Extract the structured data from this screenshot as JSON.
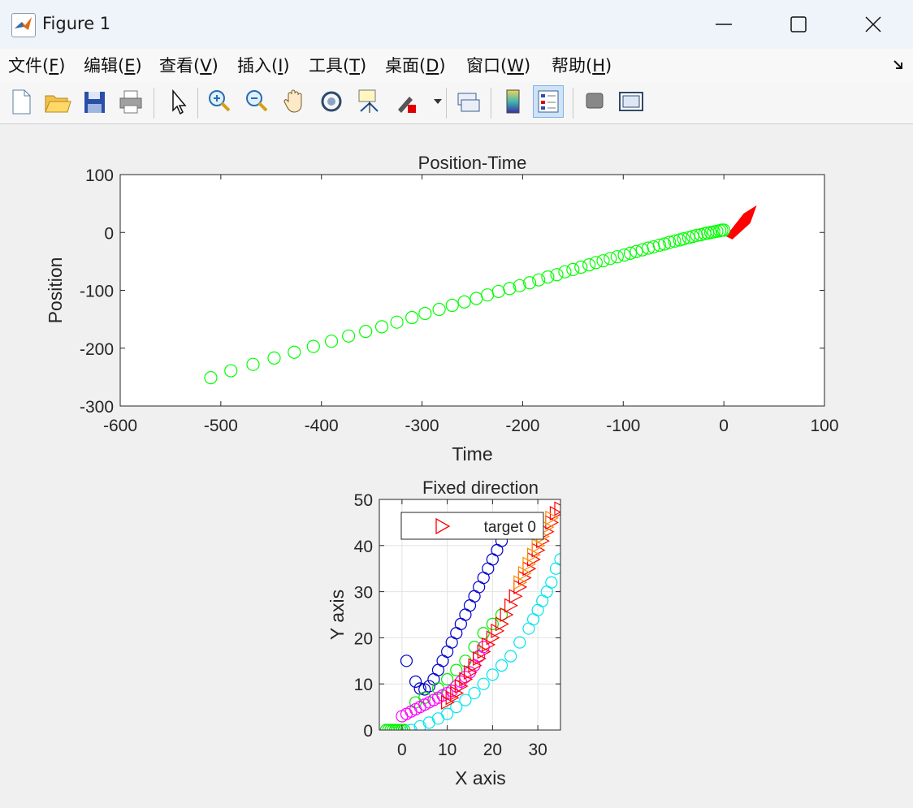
{
  "window": {
    "title": "Figure 1"
  },
  "menu": {
    "file": "文件(",
    "file_key": "F",
    "file_end": ")",
    "edit": "编辑(",
    "edit_key": "E",
    "edit_end": ")",
    "view": "查看(",
    "view_key": "V",
    "view_end": ")",
    "insert": "插入(",
    "insert_key": "I",
    "insert_end": ")",
    "tools": "工具(",
    "tools_key": "T",
    "tools_end": ")",
    "desktop": "桌面(",
    "desktop_key": "D",
    "desktop_end": ")",
    "window": "窗口(",
    "window_key": "W",
    "window_end": ")",
    "help": "帮助(",
    "help_key": "H",
    "help_end": ")"
  },
  "toolbar": {
    "icons": [
      "new-file-icon",
      "open-folder-icon",
      "save-icon",
      "print-icon",
      "pointer-icon",
      "zoom-in-icon",
      "zoom-out-icon",
      "pan-hand-icon",
      "rotate-3d-icon",
      "data-cursor-icon",
      "brush-icon",
      "link-plot-icon",
      "colorbar-icon",
      "legend-icon",
      "hide-plot-tools-icon",
      "show-plot-tools-icon"
    ]
  },
  "chart_data": [
    {
      "type": "scatter",
      "title": "Position-Time",
      "xlabel": "Time",
      "ylabel": "Position",
      "xlim": [
        -600,
        100
      ],
      "ylim": [
        -300,
        100
      ],
      "xticks": [
        "-600",
        "-500",
        "-400",
        "-300",
        "-200",
        "-100",
        "0",
        "100"
      ],
      "yticks": [
        "100",
        "0",
        "-100",
        "-200",
        "-300"
      ],
      "grid": false,
      "series": [
        {
          "marker": "circle",
          "color": "#00ff00",
          "x": [
            -510,
            -490,
            -468,
            -447,
            -427,
            -408,
            -390,
            -373,
            -356,
            -340,
            -325,
            -310,
            -297,
            -283,
            -270,
            -258,
            -246,
            -235,
            -224,
            -213,
            -203,
            -193,
            -184,
            -175,
            -166,
            -158,
            -150,
            -142,
            -134,
            -127,
            -120,
            -113,
            -106,
            -99,
            -93,
            -87,
            -81,
            -75,
            -70,
            -64,
            -59,
            -54,
            -49,
            -44,
            -40,
            -35,
            -31,
            -27,
            -23,
            -19,
            -16,
            -13,
            -10,
            -7,
            -4,
            -2,
            0
          ],
          "y": [
            -251,
            -239,
            -228,
            -217,
            -207,
            -197,
            -188,
            -179,
            -171,
            -163,
            -155,
            -147,
            -140,
            -133,
            -126,
            -120,
            -114,
            -108,
            -102,
            -97,
            -92,
            -87,
            -82,
            -77,
            -73,
            -68,
            -64,
            -60,
            -56,
            -52,
            -49,
            -45,
            -42,
            -39,
            -36,
            -33,
            -30,
            -27,
            -25,
            -22,
            -20,
            -17,
            -15,
            -13,
            -11,
            -9,
            -7,
            -5,
            -4,
            -2,
            -1,
            0,
            1,
            2,
            3,
            4,
            4
          ]
        }
      ],
      "annotation": {
        "shape": "arrow",
        "color": "#ff0000"
      }
    },
    {
      "type": "scatter",
      "title": "Fixed direction",
      "xlabel": "X axis",
      "ylabel": "Y axis",
      "xlim": [
        -5,
        35
      ],
      "ylim": [
        0,
        50
      ],
      "xticks": [
        "0",
        "10",
        "20",
        "30"
      ],
      "yticks": [
        "50",
        "40",
        "30",
        "20",
        "10",
        "0"
      ],
      "grid": true,
      "legend": {
        "label": "target 0",
        "marker": "triangle-right",
        "color": "#ff0000",
        "placement": "top"
      },
      "series": [
        {
          "color": "#0000cc",
          "marker": "circle",
          "x": [
            1,
            3,
            4,
            5,
            6,
            7,
            8,
            9,
            10,
            11,
            12,
            13,
            14,
            15,
            16,
            17,
            18,
            19,
            20,
            21,
            22,
            23,
            24
          ],
          "y": [
            15,
            10.5,
            9,
            8.8,
            9.5,
            11,
            13,
            15,
            17,
            19,
            21,
            23,
            25,
            27,
            29,
            31,
            33,
            35,
            37,
            39,
            41,
            43,
            44
          ]
        },
        {
          "color": "#00ee00",
          "marker": "circle",
          "x": [
            -3.5,
            -3,
            -2.5,
            -2,
            -1.5,
            -1,
            -0.5,
            0,
            0.5,
            3,
            5,
            8,
            10,
            12,
            14,
            16,
            18,
            20,
            22
          ],
          "y": [
            0,
            0,
            0,
            0,
            0,
            0,
            0,
            0,
            0,
            6,
            7,
            9,
            11,
            13,
            15,
            18,
            21,
            23,
            25
          ]
        },
        {
          "color": "#ff00ff",
          "marker": "circle",
          "x": [
            0,
            1,
            2,
            3,
            4,
            5,
            6,
            7,
            8,
            9,
            10,
            11,
            12,
            13,
            14,
            15,
            16,
            17,
            18
          ],
          "y": [
            3,
            3.5,
            4,
            4.5,
            5,
            5.5,
            6,
            6.5,
            7,
            7.5,
            8,
            8.5,
            9.5,
            10.5,
            11.5,
            12.5,
            14,
            16,
            18
          ]
        },
        {
          "color": "#00e5ee",
          "marker": "circle",
          "x": [
            2,
            4,
            6,
            8,
            10,
            12,
            14,
            16,
            18,
            20,
            22,
            24,
            26,
            28,
            29,
            30,
            31,
            32,
            33,
            34,
            35
          ],
          "y": [
            0,
            0.8,
            1.6,
            2.5,
            3.5,
            5,
            6.5,
            8,
            10,
            12,
            14,
            16,
            19,
            22,
            24,
            26,
            28,
            30,
            32,
            35,
            37
          ]
        },
        {
          "color": "#ff0000",
          "marker": "triangle-right",
          "x": [
            10,
            11,
            12,
            13,
            14,
            15,
            16,
            17,
            18,
            19,
            20,
            21,
            22,
            23,
            24,
            25,
            26,
            27,
            28,
            29,
            30,
            31,
            32,
            33,
            34,
            35
          ],
          "y": [
            6,
            7,
            8,
            9.5,
            11,
            12.5,
            14,
            15.5,
            17,
            18.5,
            20,
            21.5,
            23,
            25,
            27,
            29,
            31,
            33,
            35,
            37,
            39,
            41,
            43,
            45,
            47,
            48
          ]
        },
        {
          "color": "#ff8c00",
          "marker": "triangle-right",
          "x": [
            26,
            27,
            28,
            29,
            30,
            31,
            32,
            33
          ],
          "y": [
            32,
            34,
            36,
            38,
            40,
            42,
            44,
            46
          ]
        }
      ]
    }
  ]
}
